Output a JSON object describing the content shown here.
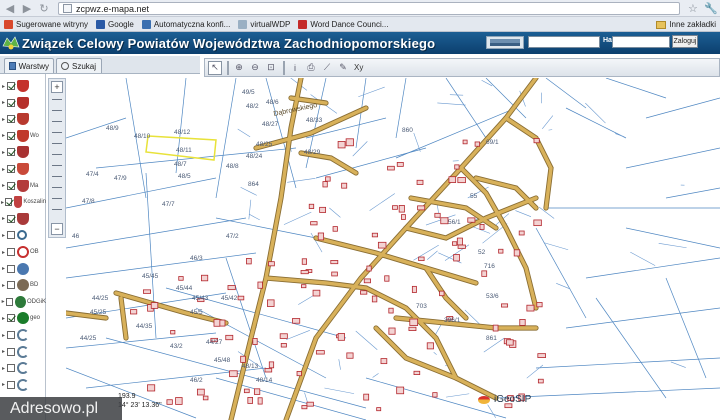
{
  "browser": {
    "url": "zcpwz.e-mapa.net",
    "bookmarks": [
      {
        "label": "Sugerowane witryny",
        "color": "#d8482c"
      },
      {
        "label": "Google",
        "color": "#2a5aa6"
      },
      {
        "label": "Automatyczna konfi...",
        "color": "#3a6fb0"
      },
      {
        "label": "virtualWDP",
        "color": "#9ab0c4"
      },
      {
        "label": "Word Dance Counci...",
        "color": "#c42a2a"
      }
    ],
    "other_bookmarks": "Inne zakładki"
  },
  "header": {
    "title": "Związek Celowy Powiatów Województwa Zachodniopomorskiego",
    "login_label": "Hasło:",
    "login_button": "Zaloguj"
  },
  "left_panel": {
    "tabs": [
      {
        "label": "Warstwy"
      },
      {
        "label": "Szukaj"
      }
    ],
    "layers": [
      {
        "icon": "crest-icon",
        "color": "#c4322c",
        "checked": true,
        "text": ""
      },
      {
        "icon": "crest-icon",
        "color": "#b52f2a",
        "checked": true,
        "text": ""
      },
      {
        "icon": "crest-icon",
        "color": "#b83a2f",
        "checked": true,
        "text": ""
      },
      {
        "icon": "crest-icon",
        "color": "#c0392b",
        "checked": true,
        "text": "Wo"
      },
      {
        "icon": "crest-icon",
        "color": "#a83232",
        "checked": true,
        "text": ""
      },
      {
        "icon": "crest-icon",
        "color": "#c94a3a",
        "checked": true,
        "text": ""
      },
      {
        "icon": "crest-icon",
        "color": "#b33b3b",
        "checked": true,
        "text": "Ma"
      },
      {
        "icon": "crest-icon",
        "color": "#c14141",
        "checked": true,
        "text": "Koszalin"
      },
      {
        "icon": "crest-icon",
        "color": "#a93a3a",
        "checked": true,
        "text": ""
      },
      {
        "icon": "search-icon",
        "color": "#3b6a8f",
        "checked": false,
        "text": ""
      },
      {
        "icon": "no-entry-icon",
        "color": "#c62f2f",
        "checked": false,
        "text": "OB"
      },
      {
        "icon": "globe-icon",
        "color": "#4a78b0",
        "checked": false,
        "text": ""
      },
      {
        "icon": "mountain-icon",
        "color": "#7b6a55",
        "checked": false,
        "text": "BD"
      },
      {
        "icon": "odgik-icon",
        "color": "#2d7a3a",
        "checked": false,
        "text": "ODGiK"
      },
      {
        "icon": "leaf-icon",
        "color": "#1a7c2a",
        "checked": true,
        "text": "geo"
      },
      {
        "icon": "g-icon",
        "color": "#5a7a95",
        "checked": false,
        "text": ""
      },
      {
        "icon": "g-icon",
        "color": "#5a7a95",
        "checked": false,
        "text": ""
      },
      {
        "icon": "g-icon",
        "color": "#5a7a95",
        "checked": false,
        "text": ""
      },
      {
        "icon": "g-icon",
        "color": "#5a7a95",
        "checked": false,
        "text": ""
      }
    ]
  },
  "toolbar": {
    "tools": [
      "pointer-icon",
      "zoom-in-icon",
      "zoom-out-icon",
      "zoom-extent-icon",
      "info-icon",
      "print-icon",
      "measure-icon",
      "pencil-icon"
    ],
    "xy_label": "Xy"
  },
  "map": {
    "parcels": [
      {
        "label": "48/9"
      },
      {
        "label": "48/10"
      },
      {
        "label": "48/12"
      },
      {
        "label": "48/11"
      },
      {
        "label": "48/7"
      },
      {
        "label": "48/5"
      },
      {
        "label": "47/4"
      },
      {
        "label": "47/9"
      },
      {
        "label": "47/8"
      },
      {
        "label": "47/7"
      },
      {
        "label": "47/2"
      },
      {
        "label": "46"
      },
      {
        "label": "46/3"
      },
      {
        "label": "45/45"
      },
      {
        "label": "45/44"
      },
      {
        "label": "45/43"
      },
      {
        "label": "45/42"
      },
      {
        "label": "44/35"
      },
      {
        "label": "44/25"
      },
      {
        "label": "44/27"
      },
      {
        "label": "43/2"
      },
      {
        "label": "48/27"
      },
      {
        "label": "48/25"
      },
      {
        "label": "48/33"
      },
      {
        "label": "48/29"
      },
      {
        "label": "48/24"
      },
      {
        "label": "48/8"
      },
      {
        "label": "48/2"
      },
      {
        "label": "864"
      },
      {
        "label": "860"
      },
      {
        "label": "861"
      },
      {
        "label": "716"
      },
      {
        "label": "69/1"
      },
      {
        "label": "703"
      },
      {
        "label": "56/1"
      },
      {
        "label": "53/6"
      },
      {
        "label": "55"
      },
      {
        "label": "52"
      },
      {
        "label": "396/1"
      },
      {
        "label": "48/6"
      },
      {
        "label": "49/5"
      },
      {
        "label": "48/14"
      },
      {
        "label": "48/13"
      },
      {
        "label": "46/2"
      },
      {
        "label": "45/48"
      },
      {
        "label": "45/5"
      },
      {
        "label": "44/25"
      },
      {
        "label": "45/25"
      }
    ],
    "street": "Dąbrowskiego",
    "coord_x": "193.9",
    "coord_lon": "14° 23' 13.36\"",
    "geosip": "iGeoSIP"
  },
  "watermark": "Adresowo.pl"
}
